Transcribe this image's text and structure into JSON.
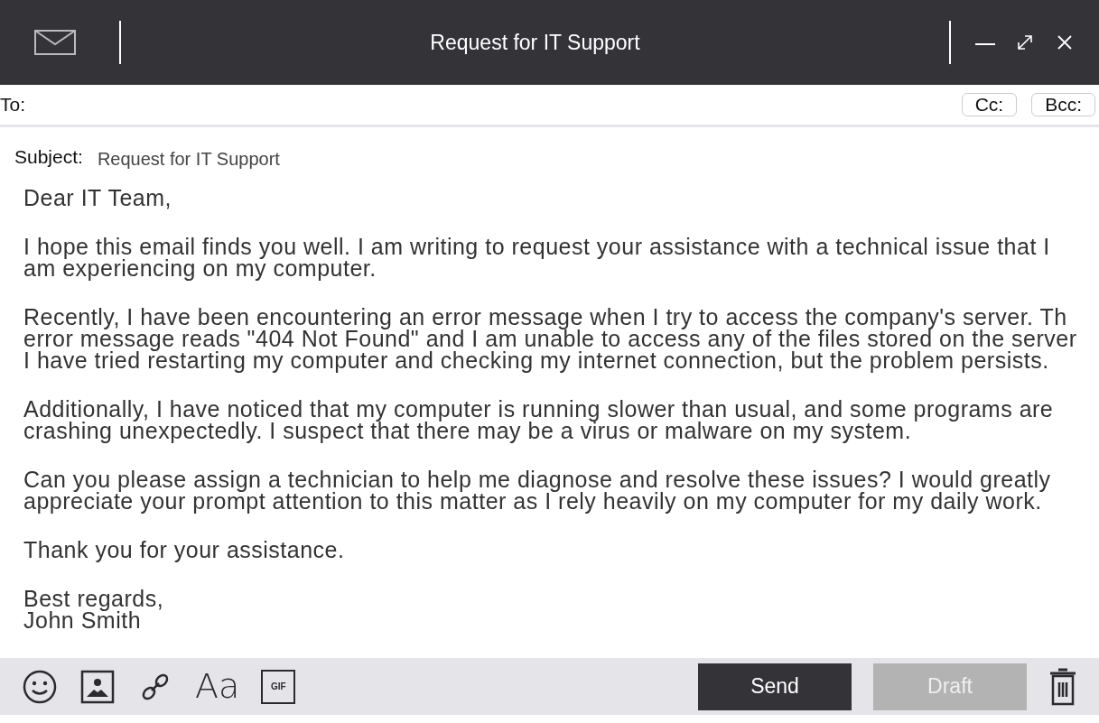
{
  "window": {
    "title": "Request for IT Support"
  },
  "to": {
    "label": "To:"
  },
  "cc_buttons": [
    "Cc:",
    "Bcc:"
  ],
  "subject": {
    "label": "Subject:",
    "value": "Request for IT Support"
  },
  "body": [
    [
      "Dear IT Team,"
    ],
    [
      "I hope this email finds you well. I am writing to request your assistance with a technical issue that I",
      "am experiencing on my computer."
    ],
    [
      "Recently, I have been encountering an error message when I try to access the company's server. Th",
      "error message reads \"404 Not Found\" and I am unable to access any of the files stored on the server",
      "I have tried restarting my computer and checking my internet connection, but the problem persists."
    ],
    [
      "Additionally, I have noticed that my computer is running slower than usual, and some programs are",
      "crashing unexpectedly. I suspect that there may be a virus or malware on my system."
    ],
    [
      "Can you please assign a technician to help me diagnose and resolve these issues? I would greatly",
      "appreciate your prompt attention to this matter as I rely heavily on my computer for my daily work."
    ],
    [
      "Thank you for your assistance."
    ],
    [
      "Best regards,",
      "John Smith"
    ]
  ],
  "toolbar": {
    "format_label": "Aa",
    "gif_label": "GIF"
  },
  "actions": [
    {
      "label": "Send",
      "disabled": false
    },
    {
      "label": "Draft",
      "disabled": true
    }
  ]
}
